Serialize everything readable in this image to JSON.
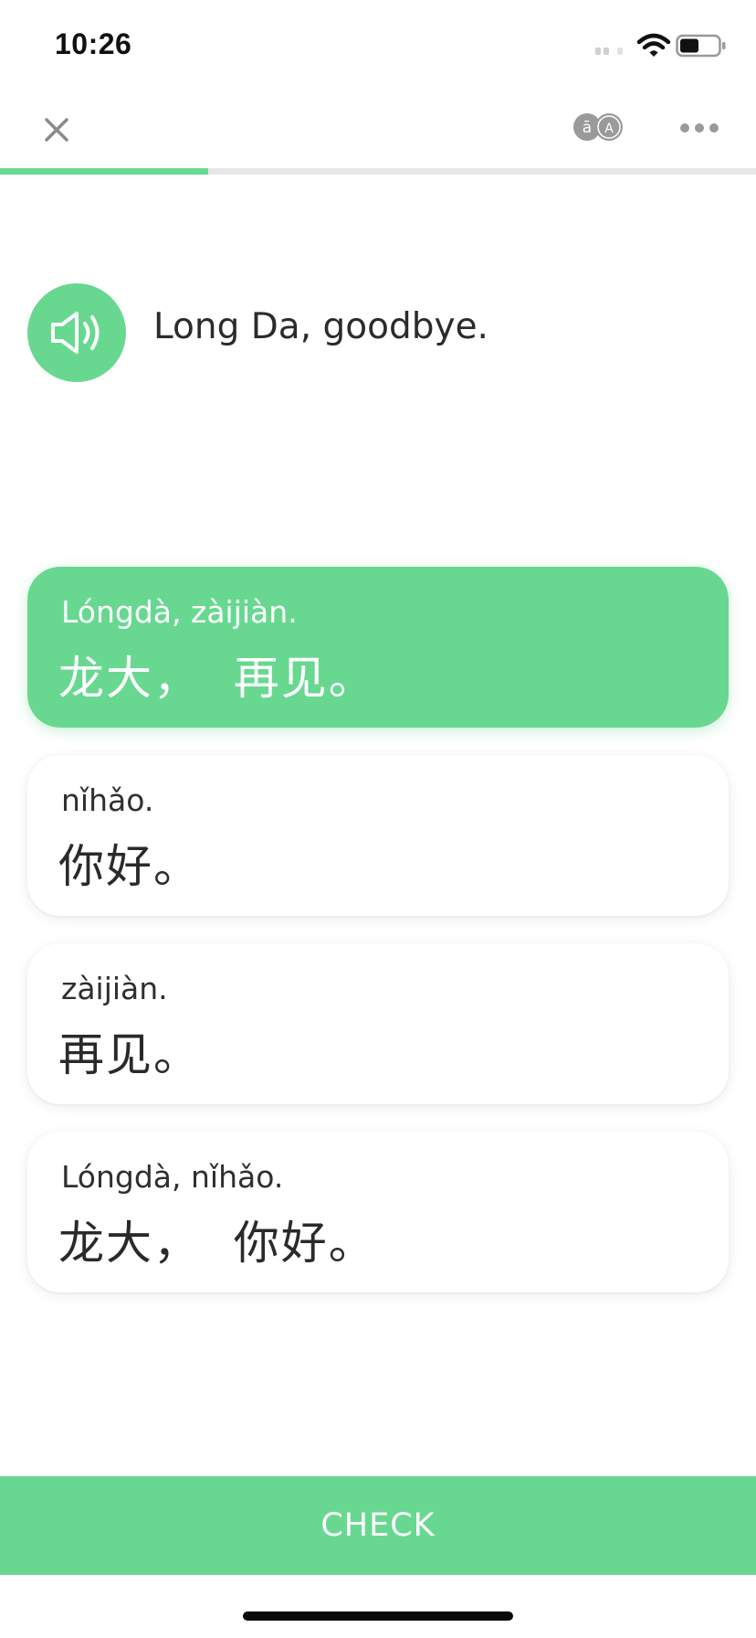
{
  "status_bar": {
    "time": "10:26",
    "icons": [
      "signal-icon",
      "wifi-icon",
      "battery-icon"
    ]
  },
  "toolbar": {
    "close_icon": "close-icon",
    "pinyin_toggle_icon": "pinyin-toggle-icon",
    "more_icon": "more-icon"
  },
  "progress": {
    "value": 0.275
  },
  "prompt": {
    "audio_icon": "speaker-icon",
    "text": "Long Da, goodbye."
  },
  "options": [
    {
      "pinyin": "Lóngdà, zàijiàn.",
      "hanzi": "龙大，  再见。",
      "selected": true
    },
    {
      "pinyin": "nǐhǎo.",
      "hanzi": "你好。",
      "selected": false
    },
    {
      "pinyin": "zàijiàn.",
      "hanzi": "再见。",
      "selected": false
    },
    {
      "pinyin": "Lóngdà, nǐhǎo.",
      "hanzi": "龙大，  你好。",
      "selected": false
    }
  ],
  "check_button": {
    "label": "CHECK"
  },
  "colors": {
    "accent": "#68d891",
    "text": "#2b2b2b",
    "progress_track": "#e6e6e6"
  }
}
